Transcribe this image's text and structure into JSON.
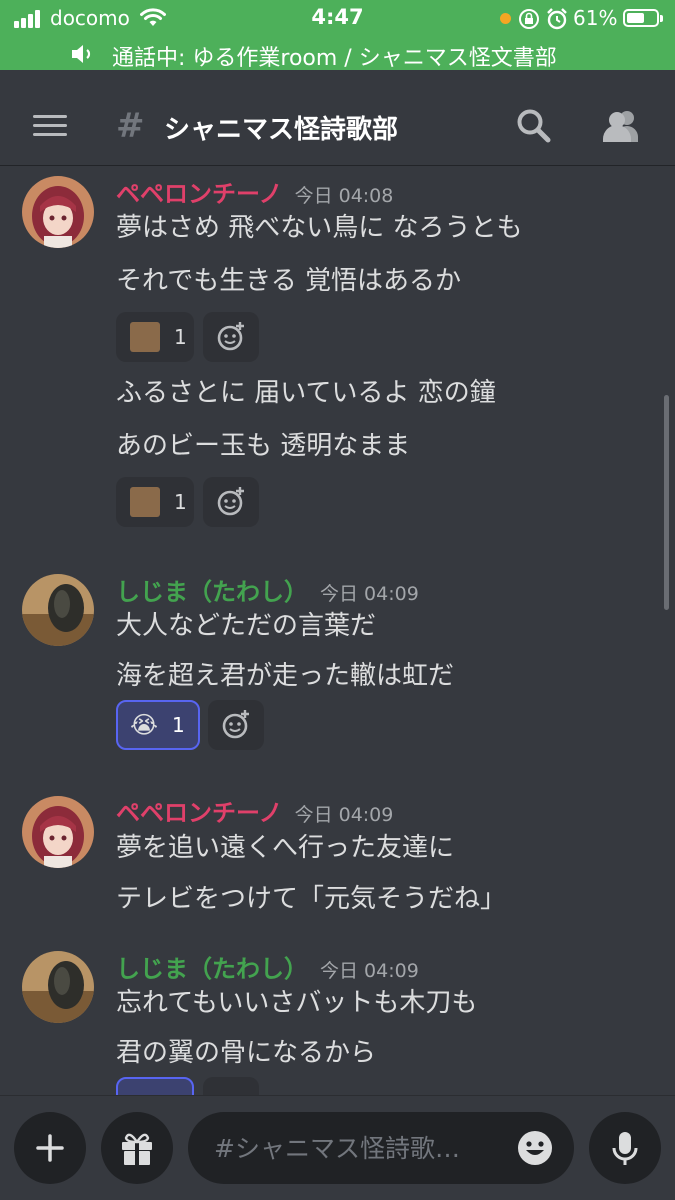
{
  "status_bar": {
    "carrier": "docomo",
    "time": "4:47",
    "battery_percent": "61%",
    "battery_level": 0.61,
    "call_text": "通話中: ゆる作業room / シャニマス怪文書部"
  },
  "header": {
    "hash": "#",
    "channel_name": "シャニマス怪詩歌部"
  },
  "messages": [
    {
      "author": "ペペロンチーノ",
      "timestamp": "今日 04:08",
      "lines": [
        "夢はさめ 飛べない鳥に なろうとも",
        "それでも生きる 覚悟はあるか"
      ],
      "reaction": "1",
      "lines2": [
        "ふるさとに 届いているよ 恋の鐘",
        "あのビー玉も 透明なまま"
      ],
      "reaction2": "1"
    },
    {
      "author": "しじま（たわし）",
      "timestamp": "今日 04:09",
      "lines": [
        "大人などただの言葉だ",
        "海を超え君が走った轍は虹だ"
      ],
      "reaction_emoji": "😭",
      "reaction": "1"
    },
    {
      "author": "ペペロンチーノ",
      "timestamp": "今日 04:09",
      "lines": [
        "夢を追い遠くへ行った友達に",
        "テレビをつけて「元気そうだね」"
      ]
    },
    {
      "author": "しじま（たわし）",
      "timestamp": "今日 04:09",
      "lines": [
        "忘れてもいいさバットも木刀も",
        "君の翼の骨になるから"
      ]
    }
  ],
  "input": {
    "placeholder": "#シャニマス怪詩歌…"
  },
  "colors": {
    "status_green": "#4db05a",
    "background": "#36393f",
    "author_pink": "#e0406a",
    "author_green": "#43a34f",
    "reaction_active": "#5865f2"
  },
  "icons": [
    "signal-icon",
    "wifi-icon",
    "lock-rotation-icon",
    "alarm-icon",
    "battery-icon",
    "speaker-icon",
    "menu-icon",
    "search-icon",
    "members-icon",
    "add-reaction-icon",
    "plus-icon",
    "gift-icon",
    "emoji-icon",
    "microphone-icon"
  ]
}
